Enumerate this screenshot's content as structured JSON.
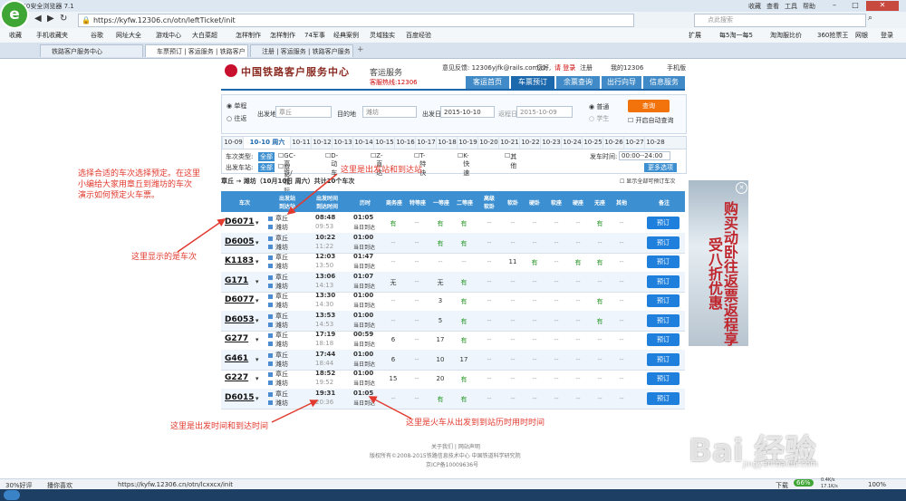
{
  "browser": {
    "title": "360安全浏览器 7.1",
    "url": "https://kyfw.12306.cn/otn/leftTicket/init",
    "search_placeholder": "点此搜索",
    "menu": [
      "收藏",
      "查看",
      "工具",
      "帮助"
    ],
    "favorites": [
      "收藏",
      "手机收藏夹",
      "谷歌",
      "网址大全",
      "游戏中心",
      "大白菜超",
      "怎样制作",
      "怎样制作",
      "74军事",
      "经典案例",
      "灵域独实",
      "百度经验"
    ],
    "favorites_right": [
      "扩展",
      "每5淘一每5",
      "淘淘服比价",
      "360抢票王",
      "网银",
      "登录"
    ],
    "tabs": [
      "铁路客户服务中心",
      "车票预订 | 客运服务 | 铁路客户",
      "注册 | 客运服务 | 铁路客户服务"
    ],
    "status": {
      "health": "30%好评",
      "mode": "播你喜欢",
      "url": "https://kyfw.12306.cn/otn/lcxxcx/init",
      "speed": "0.4K/s",
      "net": "17.1K/s",
      "pct": "66%",
      "download": "下载",
      "zoom": "100%"
    }
  },
  "site": {
    "name": "中国铁路客户服务中心",
    "service": "客运服务",
    "hotline": "客服热线:12306",
    "feedback": "意见反馈: 12306yjfk@rails.com.cn",
    "hello": "您好,",
    "login": "请 登录",
    "register": "注册",
    "my": "我的12306",
    "mobile": "手机版",
    "nav": [
      "客运首页",
      "车票预订",
      "余票查询",
      "出行向导",
      "信息服务"
    ]
  },
  "query": {
    "one_way": "单程",
    "round_trip": "往返",
    "from_label": "出发地",
    "from_value": "章丘",
    "to_label": "目的地",
    "to_value": "潍坊",
    "date_label": "出发日",
    "date_value": "2015-10-10",
    "return_label": "返程日",
    "return_value": "2015-10-09",
    "normal": "普通",
    "student": "学生",
    "button": "查询",
    "auto": "开启自动查询"
  },
  "dates": [
    "10-09",
    "10-10 周六",
    "10-11",
    "10-12",
    "10-13",
    "10-14",
    "10-15",
    "10-16",
    "10-17",
    "10-18",
    "10-19",
    "10-20",
    "10-21",
    "10-22",
    "10-23",
    "10-24",
    "10-25",
    "10-26",
    "10-27",
    "10-28"
  ],
  "filter": {
    "type_label": "车次类型:",
    "all": "全部",
    "types": [
      "GC-高铁/城际",
      "D-动车",
      "Z-直达",
      "T-特快",
      "K-快速",
      "其他"
    ],
    "depart_label": "出发车站:",
    "depart_station": "章丘",
    "time_label": "发车时间:",
    "time_value": "00:00--24:00",
    "more": "更多选项"
  },
  "results": {
    "route": "章丘 → 潍坊（10月10日 周六）共计10个车次",
    "show_all": "显示全部可预订车次",
    "headers": [
      "车次",
      "出发站\n到达站",
      "出发时间\n到达时间",
      "历时",
      "商务座",
      "特等座",
      "一等座",
      "二等座",
      "高级\n软卧",
      "软卧",
      "硬卧",
      "软座",
      "硬座",
      "无座",
      "其他",
      "备注"
    ],
    "book": "预订",
    "trains": [
      {
        "no": "D6071",
        "from": "章丘",
        "to": "潍坊",
        "dep": "08:48",
        "arr": "09:53",
        "dur": "01:05",
        "day": "当日到达",
        "cells": [
          "有",
          "--",
          "有",
          "有",
          "--",
          "--",
          "--",
          "--",
          "--",
          "有",
          "--"
        ]
      },
      {
        "no": "D6005",
        "from": "章丘",
        "to": "潍坊",
        "dep": "10:22",
        "arr": "11:22",
        "dur": "01:00",
        "day": "当日到达",
        "cells": [
          "--",
          "--",
          "有",
          "有",
          "--",
          "--",
          "--",
          "--",
          "--",
          "--",
          "--"
        ]
      },
      {
        "no": "K1183",
        "from": "章丘",
        "to": "潍坊",
        "dep": "12:03",
        "arr": "13:50",
        "dur": "01:47",
        "day": "当日到达",
        "cells": [
          "--",
          "--",
          "--",
          "--",
          "--",
          "11",
          "有",
          "--",
          "有",
          "有",
          "--"
        ]
      },
      {
        "no": "G171",
        "from": "章丘",
        "to": "潍坊",
        "dep": "13:06",
        "arr": "14:13",
        "dur": "01:07",
        "day": "当日到达",
        "cells": [
          "无",
          "--",
          "无",
          "有",
          "--",
          "--",
          "--",
          "--",
          "--",
          "--",
          "--"
        ]
      },
      {
        "no": "D6077",
        "from": "章丘",
        "to": "潍坊",
        "dep": "13:30",
        "arr": "14:30",
        "dur": "01:00",
        "day": "当日到达",
        "cells": [
          "--",
          "--",
          "3",
          "有",
          "--",
          "--",
          "--",
          "--",
          "--",
          "有",
          "--"
        ]
      },
      {
        "no": "D6053",
        "from": "章丘",
        "to": "潍坊",
        "dep": "13:53",
        "arr": "14:53",
        "dur": "01:00",
        "day": "当日到达",
        "cells": [
          "--",
          "--",
          "5",
          "有",
          "--",
          "--",
          "--",
          "--",
          "--",
          "有",
          "--"
        ]
      },
      {
        "no": "G277",
        "from": "章丘",
        "to": "潍坊",
        "dep": "17:19",
        "arr": "18:18",
        "dur": "00:59",
        "day": "当日到达",
        "cells": [
          "6",
          "--",
          "17",
          "有",
          "--",
          "--",
          "--",
          "--",
          "--",
          "--",
          "--"
        ]
      },
      {
        "no": "G461",
        "from": "章丘",
        "to": "潍坊",
        "dep": "17:44",
        "arr": "18:44",
        "dur": "01:00",
        "day": "当日到达",
        "cells": [
          "6",
          "--",
          "10",
          "17",
          "--",
          "--",
          "--",
          "--",
          "--",
          "--",
          "--"
        ]
      },
      {
        "no": "G227",
        "from": "章丘",
        "to": "潍坊",
        "dep": "18:52",
        "arr": "19:52",
        "dur": "01:00",
        "day": "当日到达",
        "cells": [
          "15",
          "--",
          "20",
          "有",
          "--",
          "--",
          "--",
          "--",
          "--",
          "--",
          "--"
        ]
      },
      {
        "no": "D6015",
        "from": "章丘",
        "to": "潍坊",
        "dep": "19:31",
        "arr": "20:36",
        "dur": "01:05",
        "day": "当日到达",
        "cells": [
          "--",
          "--",
          "有",
          "有",
          "--",
          "--",
          "--",
          "--",
          "--",
          "--",
          "--"
        ]
      }
    ]
  },
  "annotations": {
    "intro": "选择合适的车次选择预定。在这里\n小编给大家用章丘到潍坊的车次\n演示如何预定火车票。",
    "stations": "这里是出发站和到达站",
    "train_no": "这里显示的是车次",
    "times": "这里是出发时间和到达时间",
    "duration": "这里是火车从出发到到站历时用时时间"
  },
  "ad": {
    "text": "购买动卧往返票返程享受八折优惠"
  },
  "footer": {
    "links": "关于我们 | 网站声明",
    "copyright": "版权所有©2008-2015铁路信息技术中心  中国铁道科学研究院",
    "icp": "京ICP备10009636号"
  },
  "watermark": "Bai 经验",
  "watermark_sub": "jingyan.baidu.com",
  "colors": {
    "accent": "#1c68ad",
    "header": "#3c8fd0",
    "annotation": "#e23a2e",
    "book": "#1e7fdc",
    "query": "#f2720c"
  }
}
